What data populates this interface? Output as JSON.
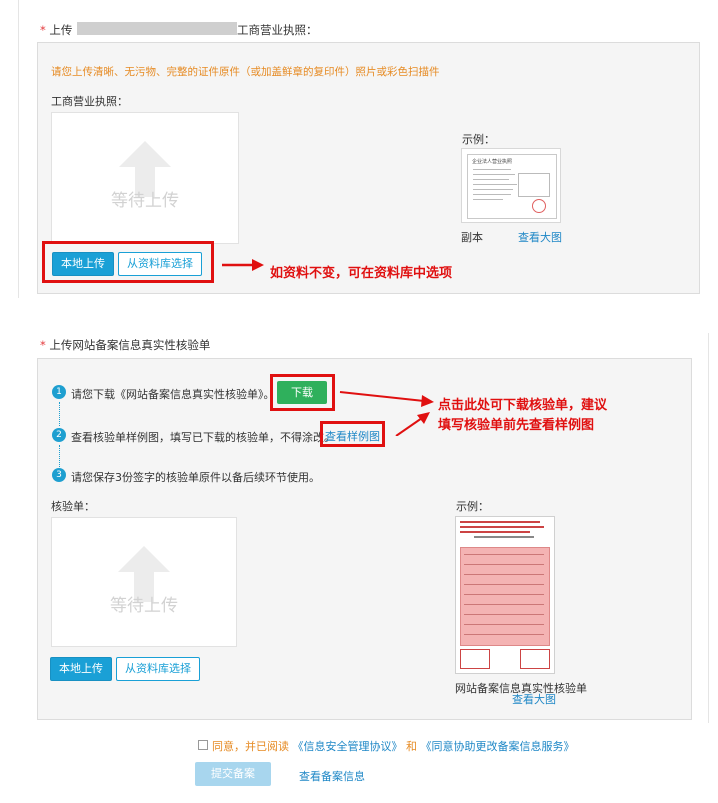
{
  "section1": {
    "required_mark": "*",
    "title_prefix": "上传",
    "title_suffix": "工商营业执照：",
    "instruction": "请您上传清晰、无污物、完整的证件原件（或加盖鲜章的复印件）照片或彩色扫描件",
    "field_label": "工商营业执照：",
    "upload_placeholder": "等待上传",
    "local_upload": "本地上传",
    "from_library": "从资料库选择",
    "example_label": "示例：",
    "sample_header": "企业法人营业执照",
    "copy_label": "副本",
    "view_large": "查看大图",
    "annotation": "如资料不变，可在资料库中选项"
  },
  "section2": {
    "required_mark": "*",
    "title": "上传网站备案信息真实性核验单",
    "steps": [
      {
        "num": "1",
        "text": "请您下载《网站备案信息真实性核验单》。",
        "action": "下载"
      },
      {
        "num": "2",
        "text": "查看核验单样例图，填写已下载的核验单，不得涂改。",
        "action": "查看样例图"
      },
      {
        "num": "3",
        "text": "请您保存3份签字的核验单原件以备后续环节使用。"
      }
    ],
    "field_label": "核验单：",
    "upload_placeholder": "等待上传",
    "local_upload": "本地上传",
    "from_library": "从资料库选择",
    "example_label": "示例：",
    "sample_caption": "网站备案信息真实性核验单",
    "view_large": "查看大图",
    "annotation_line1": "点击此处可下载核验单，建议",
    "annotation_line2": "填写核验单前先查看样例图"
  },
  "footer": {
    "agree_prefix": "同意，并已阅读",
    "agreement1": "《信息安全管理协议》",
    "and": "和",
    "agreement2": "《同意协助更改备案信息服务》",
    "submit": "提交备案",
    "view_info": "查看备案信息"
  }
}
